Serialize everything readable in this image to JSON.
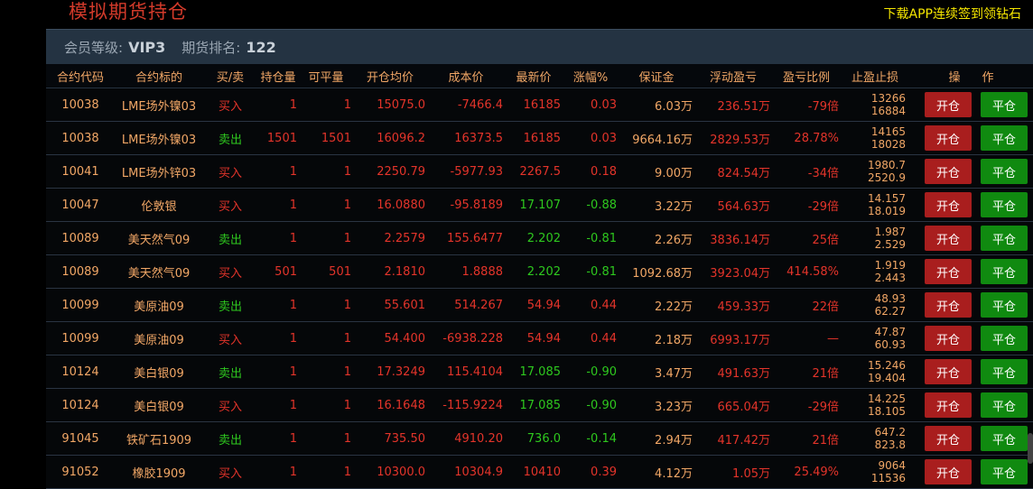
{
  "header": {
    "title": "模拟期货持仓",
    "promo": "下载APP连续签到领钻石"
  },
  "member": {
    "level_label": "会员等级:",
    "level_value": "VIP3",
    "rank_label": "期货排名:",
    "rank_value": "122"
  },
  "columns": [
    "合约代码",
    "合约标的",
    "买/卖",
    "持仓量",
    "可平量",
    "开仓均价",
    "成本价",
    "最新价",
    "涨幅%",
    "保证金",
    "浮动盈亏",
    "盈亏比例",
    "止盈止损",
    "操",
    "作"
  ],
  "colors": {
    "up": "#e4342a",
    "down": "#2ec81e",
    "neutral": "#f2a766"
  },
  "rows": [
    {
      "code": "10038",
      "name": "LME场外镍03",
      "side": "买入",
      "hold": "1",
      "avail": "1",
      "open_avg": "15075.0",
      "cost": "-7466.4",
      "last": "16185",
      "change": "0.03",
      "margin": "6.03万",
      "float_pl": "236.51万",
      "pl_ratio": "-79倍",
      "tp": "13266",
      "sl": "16884",
      "btn_open": "开仓",
      "btn_close": "平仓"
    },
    {
      "code": "10038",
      "name": "LME场外镍03",
      "side": "卖出",
      "hold": "1501",
      "avail": "1501",
      "open_avg": "16096.2",
      "cost": "16373.5",
      "last": "16185",
      "change": "0.03",
      "margin": "9664.16万",
      "float_pl": "2829.53万",
      "pl_ratio": "28.78%",
      "tp": "14165",
      "sl": "18028",
      "btn_open": "开仓",
      "btn_close": "平仓"
    },
    {
      "code": "10041",
      "name": "LME场外锌03",
      "side": "买入",
      "hold": "1",
      "avail": "1",
      "open_avg": "2250.79",
      "cost": "-5977.93",
      "last": "2267.5",
      "change": "0.18",
      "margin": "9.00万",
      "float_pl": "824.54万",
      "pl_ratio": "-34倍",
      "tp": "1980.7",
      "sl": "2520.9",
      "btn_open": "开仓",
      "btn_close": "平仓"
    },
    {
      "code": "10047",
      "name": "伦敦银",
      "side": "买入",
      "hold": "1",
      "avail": "1",
      "open_avg": "16.0880",
      "cost": "-95.8189",
      "last": "17.107",
      "change": "-0.88",
      "margin": "3.22万",
      "float_pl": "564.63万",
      "pl_ratio": "-29倍",
      "tp": "14.157",
      "sl": "18.019",
      "btn_open": "开仓",
      "btn_close": "平仓"
    },
    {
      "code": "10089",
      "name": "美天然气09",
      "side": "卖出",
      "hold": "1",
      "avail": "1",
      "open_avg": "2.2579",
      "cost": "155.6477",
      "last": "2.202",
      "change": "-0.81",
      "margin": "2.26万",
      "float_pl": "3836.14万",
      "pl_ratio": "25倍",
      "tp": "1.987",
      "sl": "2.529",
      "btn_open": "开仓",
      "btn_close": "平仓"
    },
    {
      "code": "10089",
      "name": "美天然气09",
      "side": "买入",
      "hold": "501",
      "avail": "501",
      "open_avg": "2.1810",
      "cost": "1.8888",
      "last": "2.202",
      "change": "-0.81",
      "margin": "1092.68万",
      "float_pl": "3923.04万",
      "pl_ratio": "414.58%",
      "tp": "1.919",
      "sl": "2.443",
      "btn_open": "开仓",
      "btn_close": "平仓"
    },
    {
      "code": "10099",
      "name": "美原油09",
      "side": "卖出",
      "hold": "1",
      "avail": "1",
      "open_avg": "55.601",
      "cost": "514.267",
      "last": "54.94",
      "change": "0.44",
      "margin": "2.22万",
      "float_pl": "459.33万",
      "pl_ratio": "22倍",
      "tp": "48.93",
      "sl": "62.27",
      "btn_open": "开仓",
      "btn_close": "平仓"
    },
    {
      "code": "10099",
      "name": "美原油09",
      "side": "买入",
      "hold": "1",
      "avail": "1",
      "open_avg": "54.400",
      "cost": "-6938.228",
      "last": "54.94",
      "change": "0.44",
      "margin": "2.18万",
      "float_pl": "6993.17万",
      "pl_ratio": "—",
      "tp": "47.87",
      "sl": "60.93",
      "btn_open": "开仓",
      "btn_close": "平仓"
    },
    {
      "code": "10124",
      "name": "美白银09",
      "side": "卖出",
      "hold": "1",
      "avail": "1",
      "open_avg": "17.3249",
      "cost": "115.4104",
      "last": "17.085",
      "change": "-0.90",
      "margin": "3.47万",
      "float_pl": "491.63万",
      "pl_ratio": "21倍",
      "tp": "15.246",
      "sl": "19.404",
      "btn_open": "开仓",
      "btn_close": "平仓"
    },
    {
      "code": "10124",
      "name": "美白银09",
      "side": "买入",
      "hold": "1",
      "avail": "1",
      "open_avg": "16.1648",
      "cost": "-115.9224",
      "last": "17.085",
      "change": "-0.90",
      "margin": "3.23万",
      "float_pl": "665.04万",
      "pl_ratio": "-29倍",
      "tp": "14.225",
      "sl": "18.105",
      "btn_open": "开仓",
      "btn_close": "平仓"
    },
    {
      "code": "91045",
      "name": "铁矿石1909",
      "side": "卖出",
      "hold": "1",
      "avail": "1",
      "open_avg": "735.50",
      "cost": "4910.20",
      "last": "736.0",
      "change": "-0.14",
      "margin": "2.94万",
      "float_pl": "417.42万",
      "pl_ratio": "21倍",
      "tp": "647.2",
      "sl": "823.8",
      "btn_open": "开仓",
      "btn_close": "平仓"
    },
    {
      "code": "91052",
      "name": "橡胶1909",
      "side": "买入",
      "hold": "1",
      "avail": "1",
      "open_avg": "10300.0",
      "cost": "10304.9",
      "last": "10410",
      "change": "0.39",
      "margin": "4.12万",
      "float_pl": "1.05万",
      "pl_ratio": "25.49%",
      "tp": "9064",
      "sl": "11536",
      "btn_open": "开仓",
      "btn_close": "平仓"
    }
  ],
  "row_colors": [
    {
      "side": "red",
      "last": "red",
      "change": "red",
      "cost": "red"
    },
    {
      "side": "green",
      "last": "red",
      "change": "red",
      "cost": "red"
    },
    {
      "side": "red",
      "last": "red",
      "change": "red",
      "cost": "red"
    },
    {
      "side": "red",
      "last": "green",
      "change": "green",
      "cost": "red"
    },
    {
      "side": "green",
      "last": "green",
      "change": "green",
      "cost": "red"
    },
    {
      "side": "red",
      "last": "green",
      "change": "green",
      "cost": "red"
    },
    {
      "side": "green",
      "last": "red",
      "change": "red",
      "cost": "red"
    },
    {
      "side": "red",
      "last": "red",
      "change": "red",
      "cost": "red"
    },
    {
      "side": "green",
      "last": "green",
      "change": "green",
      "cost": "red"
    },
    {
      "side": "red",
      "last": "green",
      "change": "green",
      "cost": "red"
    },
    {
      "side": "green",
      "last": "green",
      "change": "green",
      "cost": "red"
    },
    {
      "side": "red",
      "last": "red",
      "change": "red",
      "cost": "red"
    }
  ]
}
